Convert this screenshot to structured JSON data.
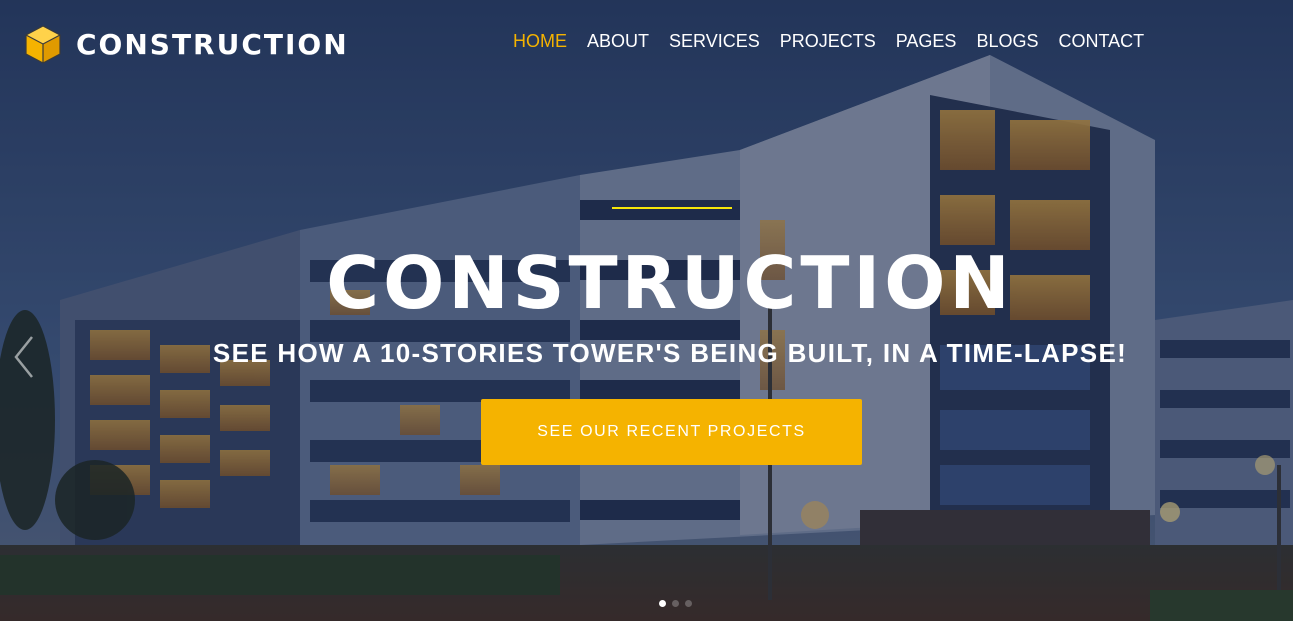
{
  "brand": {
    "name": "CONSTRUCTION",
    "icon": "cube-icon",
    "accent_color": "#f5b300"
  },
  "nav": {
    "items": [
      {
        "label": "HOME",
        "active": true
      },
      {
        "label": "ABOUT",
        "active": false
      },
      {
        "label": "SERVICES",
        "active": false
      },
      {
        "label": "PROJECTS",
        "active": false
      },
      {
        "label": "PAGES",
        "active": false
      },
      {
        "label": "BLOGS",
        "active": false
      },
      {
        "label": "CONTACT",
        "active": false
      }
    ]
  },
  "hero": {
    "title": "CONSTRUCTION",
    "subtitle": "SEE HOW A 10-STORIES TOWER'S BEING BUILT, IN A TIME-LAPSE!",
    "cta_label": "SEE OUR RECENT PROJECTS",
    "divider_color": "#f5e50a",
    "prev_icon": "chevron-left-icon",
    "slides": {
      "count": 3,
      "active": 1
    }
  }
}
